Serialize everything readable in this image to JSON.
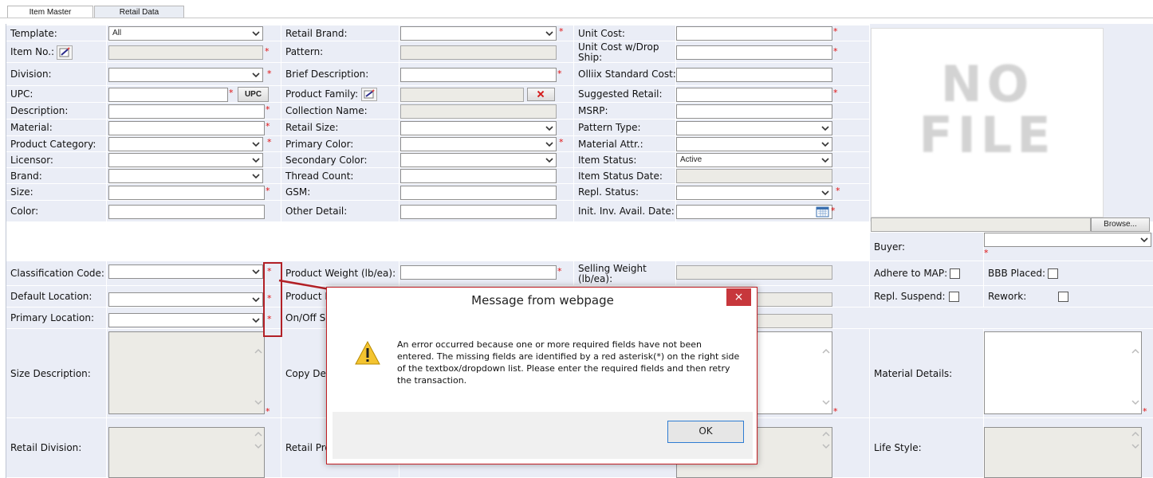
{
  "tabs": [
    {
      "label": "Item Master"
    },
    {
      "label": "Retail Data"
    }
  ],
  "col1": {
    "template": {
      "label": "Template:",
      "value": "All"
    },
    "item_no": {
      "label": "Item No.:"
    },
    "division": {
      "label": "Division:"
    },
    "upc": {
      "label": "UPC:",
      "button": "UPC"
    },
    "description": {
      "label": "Description:"
    },
    "material": {
      "label": "Material:"
    },
    "product_category": {
      "label": "Product Category:"
    },
    "licensor": {
      "label": "Licensor:"
    },
    "brand": {
      "label": "Brand:"
    },
    "size": {
      "label": "Size:"
    },
    "color": {
      "label": "Color:"
    },
    "classification_code": {
      "label": "Classification Code:"
    },
    "default_location": {
      "label": "Default Location:"
    },
    "primary_location": {
      "label": "Primary Location:"
    },
    "size_description": {
      "label": "Size Description:"
    },
    "retail_division": {
      "label": "Retail Division:"
    }
  },
  "col2": {
    "retail_brand": {
      "label": "Retail Brand:"
    },
    "pattern": {
      "label": "Pattern:"
    },
    "brief_description": {
      "label": "Brief Description:"
    },
    "product_family": {
      "label": "Product Family:"
    },
    "collection_name": {
      "label": "Collection Name:"
    },
    "retail_size": {
      "label": "Retail Size:"
    },
    "primary_color": {
      "label": "Primary Color:"
    },
    "secondary_color": {
      "label": "Secondary Color:"
    },
    "thread_count": {
      "label": "Thread Count:"
    },
    "gsm": {
      "label": "GSM:"
    },
    "other_detail": {
      "label": "Other Detail:"
    },
    "product_weight": {
      "label": "Product Weight (lb/ea):"
    },
    "product_l": {
      "label": "Product L"
    },
    "on_off": {
      "label": "On/Off S"
    },
    "copy_des": {
      "label": "Copy Des"
    },
    "retail_pro": {
      "label": "Retail Pro Category"
    }
  },
  "col3": {
    "unit_cost": {
      "label": "Unit Cost:"
    },
    "unit_cost_drop": {
      "label": "Unit Cost w/Drop Ship:"
    },
    "olliix_cost": {
      "label": "Olliix Standard Cost:"
    },
    "suggested_retail": {
      "label": "Suggested Retail:"
    },
    "msrp": {
      "label": "MSRP:"
    },
    "pattern_type": {
      "label": "Pattern Type:"
    },
    "material_attr": {
      "label": "Material Attr.:"
    },
    "item_status": {
      "label": "Item Status:",
      "value": "Active"
    },
    "item_status_date": {
      "label": "Item Status Date:"
    },
    "repl_status": {
      "label": "Repl. Status:"
    },
    "init_inv": {
      "label": "Init. Inv. Avail. Date:"
    },
    "selling_weight": {
      "label": "Selling Weight (lb/ea):"
    }
  },
  "col4": {
    "no_file_text": "NO FILE",
    "browse": "Browse...",
    "buyer": {
      "label": "Buyer:"
    },
    "adhere_map": {
      "label": "Adhere to MAP:"
    },
    "bbb_placed": {
      "label": "BBB Placed:"
    },
    "repl_suspend": {
      "label": "Repl. Suspend:"
    },
    "rework": {
      "label": "Rework:"
    },
    "material_details": {
      "label": "Material Details:"
    },
    "life_style": {
      "label": "Life Style:"
    }
  },
  "required_mark": "*",
  "dialog": {
    "title": "Message from webpage",
    "close": "×",
    "message": "An error occurred because one or more required fields have not been entered. The missing fields are identified by a red asterisk(*) on the right side of the textbox/dropdown list. Please enter the required fields and then retry the transaction.",
    "ok": "OK"
  },
  "colors": {
    "accent_red": "#b22026",
    "label_bg": "#eaedf6",
    "required": "#e01010"
  }
}
